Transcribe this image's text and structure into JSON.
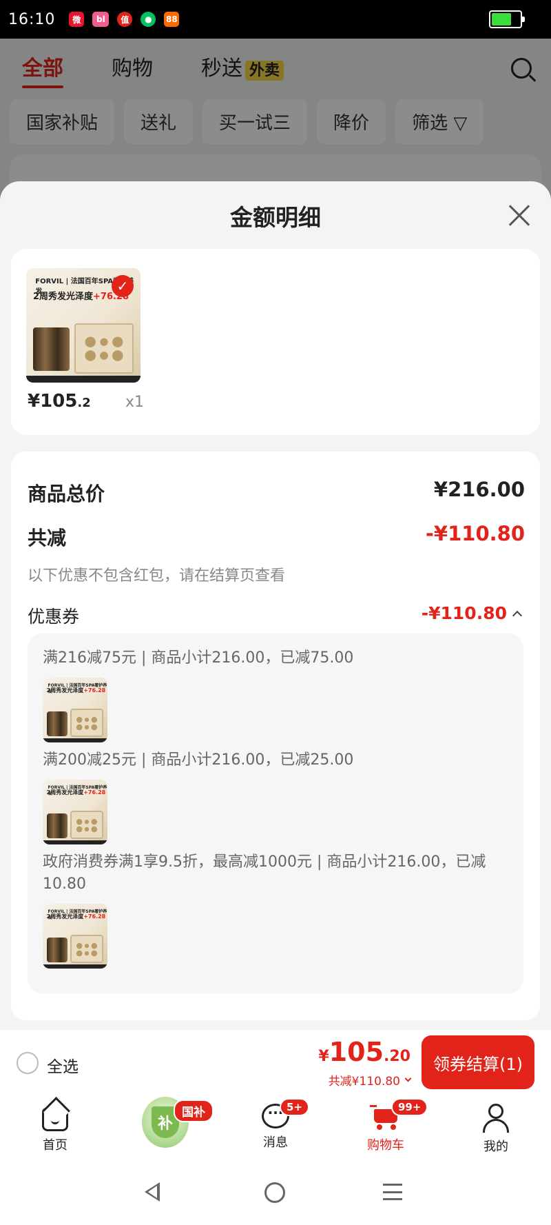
{
  "status_bar": {
    "time": "16:10",
    "battery_level": 0.7,
    "app_icons": [
      "weibo-icon",
      "bilibili-icon",
      "zhide-icon",
      "wechat-icon",
      "xiaohongshu-icon"
    ]
  },
  "background": {
    "tabs": [
      {
        "label": "全部",
        "active": true
      },
      {
        "label": "购物",
        "active": false
      },
      {
        "label": "秒送",
        "active": false,
        "tag": "外卖"
      }
    ],
    "chips": [
      "国家补贴",
      "送礼",
      "买一试三",
      "降价",
      "筛选"
    ]
  },
  "sheet": {
    "title": "金额明细",
    "product": {
      "price_int": "¥105",
      "price_dec": ".2",
      "qty": "x1",
      "thumb_brand": "FORVIL | 法国百年SPA奢护养发",
      "thumb_promo_prefix": "2周秀发光泽度",
      "thumb_promo_value": "+76.28"
    },
    "summary": {
      "total_label": "商品总价",
      "total_value": "¥216.00",
      "discount_label": "共减",
      "discount_value": "-¥110.80",
      "discount_hint": "以下优惠不包含红包，请在结算页查看",
      "coupon_label": "优惠券",
      "coupon_value": "-¥110.80"
    },
    "coupons": [
      {
        "text": "满216减75元 | 商品小计216.00，已减75.00"
      },
      {
        "text": "满200减25元 | 商品小计216.00，已减25.00"
      },
      {
        "text": "政府消费券满1享9.5折，最高减1000元 | 商品小计216.00，已减10.80"
      }
    ]
  },
  "checkout": {
    "select_all": "全选",
    "total_yen": "¥",
    "total_int": "105",
    "total_dec": ".20",
    "total_discount": "共减¥110.80",
    "button": "领券结算(1)"
  },
  "bottom_nav": [
    {
      "label": "首页",
      "icon": "home-icon"
    },
    {
      "label": "",
      "icon": "guobu-shield-icon",
      "badge": "国补"
    },
    {
      "label": "消息",
      "icon": "message-icon",
      "badge": "5+"
    },
    {
      "label": "购物车",
      "icon": "cart-icon",
      "badge": "99+",
      "active": true
    },
    {
      "label": "我的",
      "icon": "user-icon"
    }
  ],
  "colors": {
    "accent": "#e2231a",
    "sheet_bg": "#f4f4f4"
  }
}
